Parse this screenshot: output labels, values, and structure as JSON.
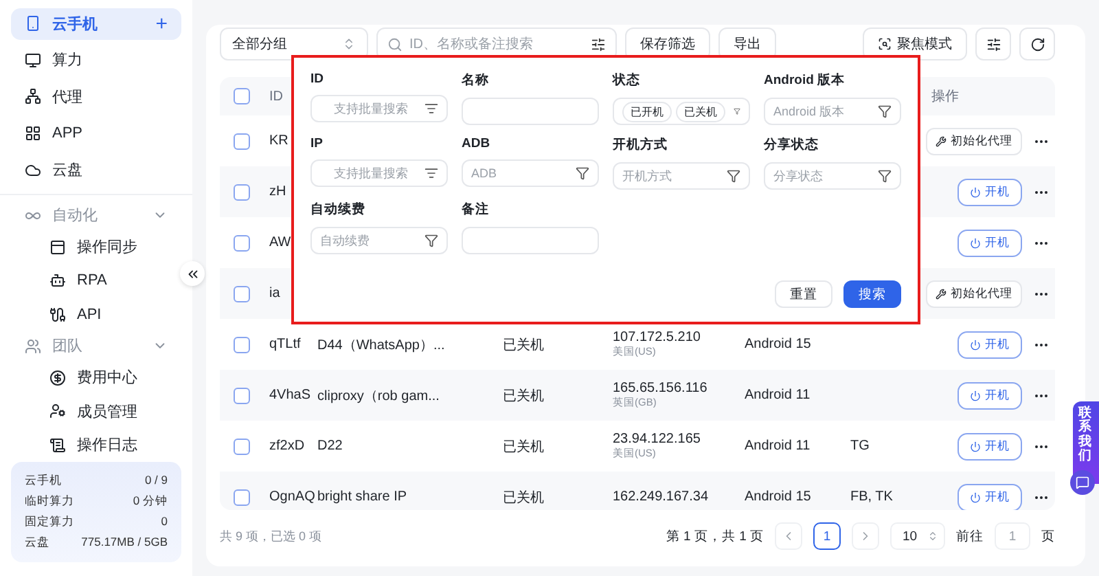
{
  "sidebar": {
    "items": [
      {
        "label": "云手机",
        "selected": true,
        "add": "+"
      },
      {
        "label": "算力",
        "selected": false
      },
      {
        "label": "代理",
        "selected": false
      },
      {
        "label": "APP",
        "selected": false
      },
      {
        "label": "云盘",
        "selected": false
      }
    ],
    "groups": [
      {
        "label": "自动化",
        "expanded": true,
        "children": [
          {
            "label": "操作同步"
          },
          {
            "label": "RPA"
          },
          {
            "label": "API"
          }
        ]
      },
      {
        "label": "团队",
        "expanded": true,
        "children": [
          {
            "label": "费用中心"
          },
          {
            "label": "成员管理"
          },
          {
            "label": "操作日志"
          }
        ]
      }
    ],
    "stats": [
      {
        "label": "云手机",
        "value": "0 / 9"
      },
      {
        "label": "临时算力",
        "value": "0 分钟"
      },
      {
        "label": "固定算力",
        "value": "0"
      },
      {
        "label": "云盘",
        "value": "775.17MB / 5GB"
      }
    ]
  },
  "toolbar": {
    "group_select": "全部分组",
    "search": {
      "placeholder": "ID、名称或备注搜索"
    },
    "buttons": [
      "保存筛选",
      "导出"
    ],
    "focus_button": "聚焦模式"
  },
  "table": {
    "columns": [
      "ID",
      "操作"
    ],
    "header_checked": false,
    "rows": [
      {
        "id": "KR",
        "checked": false,
        "action": {
          "kind": "proxy",
          "label": "初始化代理"
        }
      },
      {
        "id": "zH",
        "checked": false,
        "action": {
          "kind": "power",
          "label": "开机"
        }
      },
      {
        "id": "AW",
        "checked": false,
        "action": {
          "kind": "power",
          "label": "开机"
        }
      },
      {
        "id": "ia",
        "checked": false,
        "action": {
          "kind": "proxy",
          "label": "初始化代理"
        }
      },
      {
        "id": "qTLtf",
        "name": "D44（WhatsApp）...",
        "status": "已关机",
        "ip": "107.172.5.210",
        "region": "美国(US)",
        "android": "Android 15",
        "checked": false,
        "action": {
          "kind": "power",
          "label": "开机"
        }
      },
      {
        "id": "4VhaS",
        "name": "cliproxy（rob gam...",
        "status": "已关机",
        "ip": "165.65.156.116",
        "region": "英国(GB)",
        "android": "Android 11",
        "checked": false,
        "action": {
          "kind": "power",
          "label": "开机"
        }
      },
      {
        "id": "zf2xD",
        "name": "D22",
        "status": "已关机",
        "ip": "23.94.122.165",
        "region": "美国(US)",
        "android": "Android 11",
        "tags": "TG",
        "checked": false,
        "action": {
          "kind": "power",
          "label": "开机"
        }
      },
      {
        "id": "OgnAQ",
        "name": "bright share IP",
        "status": "已关机",
        "ip": "162.249.167.34",
        "android": "Android 15",
        "tags": "FB, TK",
        "checked": false,
        "action": {
          "kind": "power",
          "label": "开机"
        }
      }
    ]
  },
  "filter_panel": {
    "fields": [
      {
        "label": "ID",
        "kind": "batch",
        "placeholder": "支持批量搜索"
      },
      {
        "label": "名称",
        "kind": "text"
      },
      {
        "label": "状态",
        "kind": "chips",
        "chips": [
          "已开机",
          "已关机"
        ]
      },
      {
        "label": "Android 版本",
        "kind": "select",
        "placeholder": "Android 版本"
      },
      {
        "label": "IP",
        "kind": "batch",
        "placeholder": "支持批量搜索"
      },
      {
        "label": "ADB",
        "kind": "select",
        "placeholder": "ADB"
      },
      {
        "label": "开机方式",
        "kind": "select",
        "placeholder": "开机方式"
      },
      {
        "label": "分享状态",
        "kind": "select",
        "placeholder": "分享状态"
      },
      {
        "label": "自动续费",
        "kind": "select",
        "placeholder": "自动续费"
      },
      {
        "label": "备注",
        "kind": "text"
      }
    ],
    "buttons": [
      {
        "label": "重置",
        "primary": false
      },
      {
        "label": "搜索",
        "primary": true
      }
    ]
  },
  "footer": {
    "summary": "共 9 项，已选 0 项",
    "page_info": "第 1 页，共 1 页",
    "pages": [
      {
        "label": "1",
        "selected": true
      }
    ],
    "page_size": "10",
    "goto_label": "前往",
    "goto_value": "1",
    "goto_suffix": "页"
  },
  "contact_tab": "联系我们"
}
